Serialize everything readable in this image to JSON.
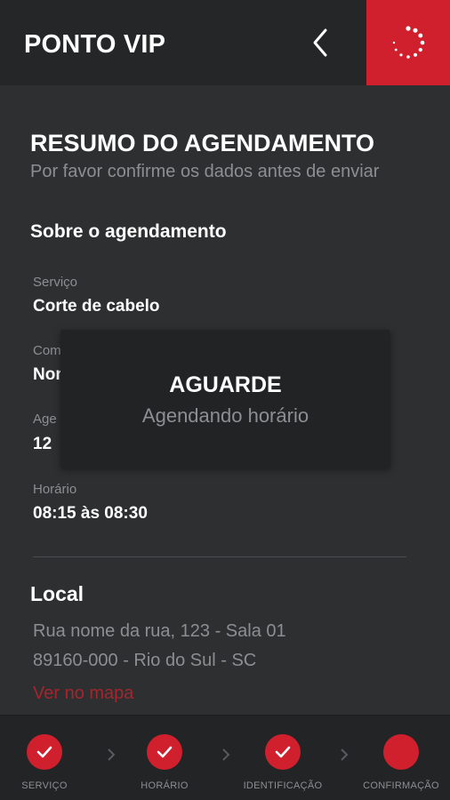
{
  "header": {
    "title": "PONTO VIP",
    "back_icon": "chevron-left-icon",
    "action_icon": "loading-spinner-icon"
  },
  "summary": {
    "title": "RESUMO DO AGENDAMENTO",
    "subtitle": "Por favor confirme os dados antes de enviar"
  },
  "about": {
    "title": "Sobre o agendamento",
    "fields": [
      {
        "label": "Serviço",
        "value": "Corte de cabelo"
      },
      {
        "label": "Com",
        "value": "Nom"
      },
      {
        "label": "Age",
        "value": "12"
      },
      {
        "label": "Horário",
        "value": "08:15 às 08:30"
      }
    ]
  },
  "location": {
    "title": "Local",
    "address_line1": "Rua nome da rua, 123 - Sala 01",
    "address_line2": "89160-000 - Rio do Sul - SC",
    "map_link": "Ver no mapa"
  },
  "dialog": {
    "title": "AGUARDE",
    "message": "Agendando horário"
  },
  "steps": [
    {
      "label": "SERVIÇO",
      "completed": true
    },
    {
      "label": "HORÁRIO",
      "completed": true
    },
    {
      "label": "IDENTIFICAÇÃO",
      "completed": true
    },
    {
      "label": "CONFIRMAÇÃO",
      "completed": false
    }
  ],
  "colors": {
    "accent": "#d0202d",
    "background": "#2e2f31",
    "header": "#252628",
    "muted_text": "#8d8e91",
    "link": "#a3262e"
  }
}
